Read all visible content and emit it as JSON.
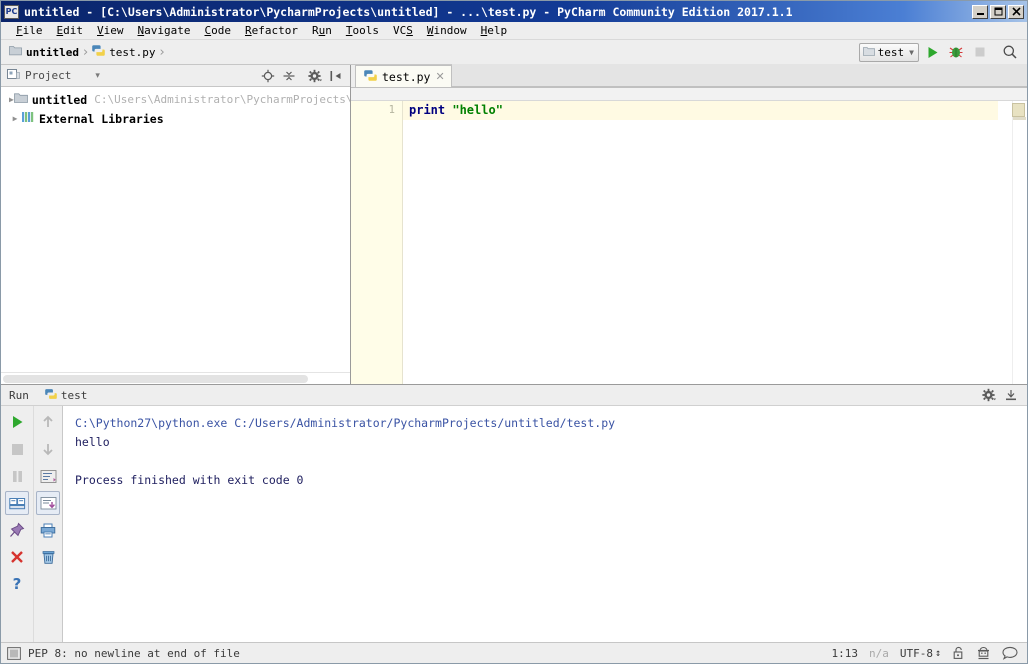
{
  "window": {
    "title": "untitled - [C:\\Users\\Administrator\\PycharmProjects\\untitled] - ...\\test.py - PyCharm Community Edition 2017.1.1",
    "app_icon_label": "PC",
    "minimize_label": "Minimize",
    "maximize_label": "Maximize",
    "close_label": "Close"
  },
  "menubar": {
    "items": [
      {
        "label": "File",
        "mnemonic": "F"
      },
      {
        "label": "Edit",
        "mnemonic": "E"
      },
      {
        "label": "View",
        "mnemonic": "V"
      },
      {
        "label": "Navigate",
        "mnemonic": "N"
      },
      {
        "label": "Code",
        "mnemonic": "C"
      },
      {
        "label": "Refactor",
        "mnemonic": "R"
      },
      {
        "label": "Run",
        "mnemonic": "u"
      },
      {
        "label": "Tools",
        "mnemonic": "T"
      },
      {
        "label": "VCS",
        "mnemonic": "S"
      },
      {
        "label": "Window",
        "mnemonic": "W"
      },
      {
        "label": "Help",
        "mnemonic": "H"
      }
    ]
  },
  "navbar": {
    "breadcrumbs": [
      {
        "label": "untitled",
        "icon": "folder-icon"
      },
      {
        "label": "test.py",
        "icon": "python-file-icon"
      }
    ],
    "separator": "›",
    "run_config": {
      "label": "test",
      "icon": "folder-icon",
      "caret": "▾"
    },
    "buttons": [
      {
        "name": "run-button",
        "icon": "play-icon"
      },
      {
        "name": "debug-button",
        "icon": "bug-icon"
      },
      {
        "name": "stop-button",
        "icon": "stop-icon"
      },
      {
        "name": "search-everywhere-button",
        "icon": "search-icon"
      }
    ]
  },
  "project_panel": {
    "title": "Project",
    "caret": "▾",
    "tools": [
      {
        "name": "locate-file-button",
        "icon": "target-icon"
      },
      {
        "name": "collapse-all-button",
        "icon": "collapse-icon"
      },
      {
        "name": "settings-button",
        "icon": "gear-icon"
      },
      {
        "name": "hide-panel-button",
        "icon": "hide-icon"
      }
    ],
    "tree": [
      {
        "label": "untitled",
        "path": "C:\\Users\\Administrator\\PycharmProjects\\u",
        "icon": "folder-icon",
        "expander": "▶",
        "indent": 0
      },
      {
        "label": "External Libraries",
        "path": "",
        "icon": "library-icon",
        "expander": "▶",
        "indent": 0
      }
    ]
  },
  "editor": {
    "tabs": [
      {
        "label": "test.py",
        "icon": "python-file-icon",
        "close": "✕",
        "active": true
      }
    ],
    "line_numbers": [
      "1"
    ],
    "code": {
      "keyword": "print",
      "space": " ",
      "string": "\"hello\""
    }
  },
  "run_window": {
    "title": "Run",
    "tab_label": "test",
    "tab_icon": "python-file-icon",
    "header_buttons": [
      {
        "name": "run-settings-button",
        "icon": "gear-icon"
      },
      {
        "name": "hide-run-panel-button",
        "icon": "hide-icon"
      }
    ],
    "toolbar_left": [
      {
        "name": "rerun-button",
        "icon": "play-icon"
      },
      {
        "name": "stop-button",
        "icon": "stop-icon"
      },
      {
        "name": "pause-button",
        "icon": "pause-icon"
      },
      {
        "name": "console-toggle-button",
        "icon": "console-icon"
      },
      {
        "name": "pin-tab-button",
        "icon": "pin-icon"
      },
      {
        "name": "close-button",
        "icon": "close-x-icon"
      },
      {
        "name": "help-button",
        "icon": "question-icon"
      }
    ],
    "toolbar_right": [
      {
        "name": "previous-occurrence-button",
        "icon": "arrow-up-icon"
      },
      {
        "name": "next-occurrence-button",
        "icon": "arrow-down-icon"
      },
      {
        "name": "soft-wrap-button",
        "icon": "soft-wrap-icon"
      },
      {
        "name": "scroll-to-end-button",
        "icon": "scroll-end-icon"
      },
      {
        "name": "print-button",
        "icon": "printer-icon"
      },
      {
        "name": "clear-all-button",
        "icon": "trash-icon"
      }
    ],
    "console": [
      {
        "text": "C:\\Python27\\python.exe C:/Users/Administrator/PycharmProjects/untitled/test.py",
        "style": "cmd"
      },
      {
        "text": "hello",
        "style": "out"
      },
      {
        "text": "",
        "style": "blank"
      },
      {
        "text": "Process finished with exit code 0",
        "style": "out"
      }
    ]
  },
  "statusbar": {
    "message": "PEP 8: no newline at end of file",
    "message_icon": "info-window-icon",
    "caret_position": "1:13",
    "line_separator": "n/a",
    "encoding": "UTF-8",
    "encoding_caret": "↕",
    "icons": [
      {
        "name": "lock-icon"
      },
      {
        "name": "inspector-icon"
      },
      {
        "name": "event-log-icon"
      }
    ]
  }
}
